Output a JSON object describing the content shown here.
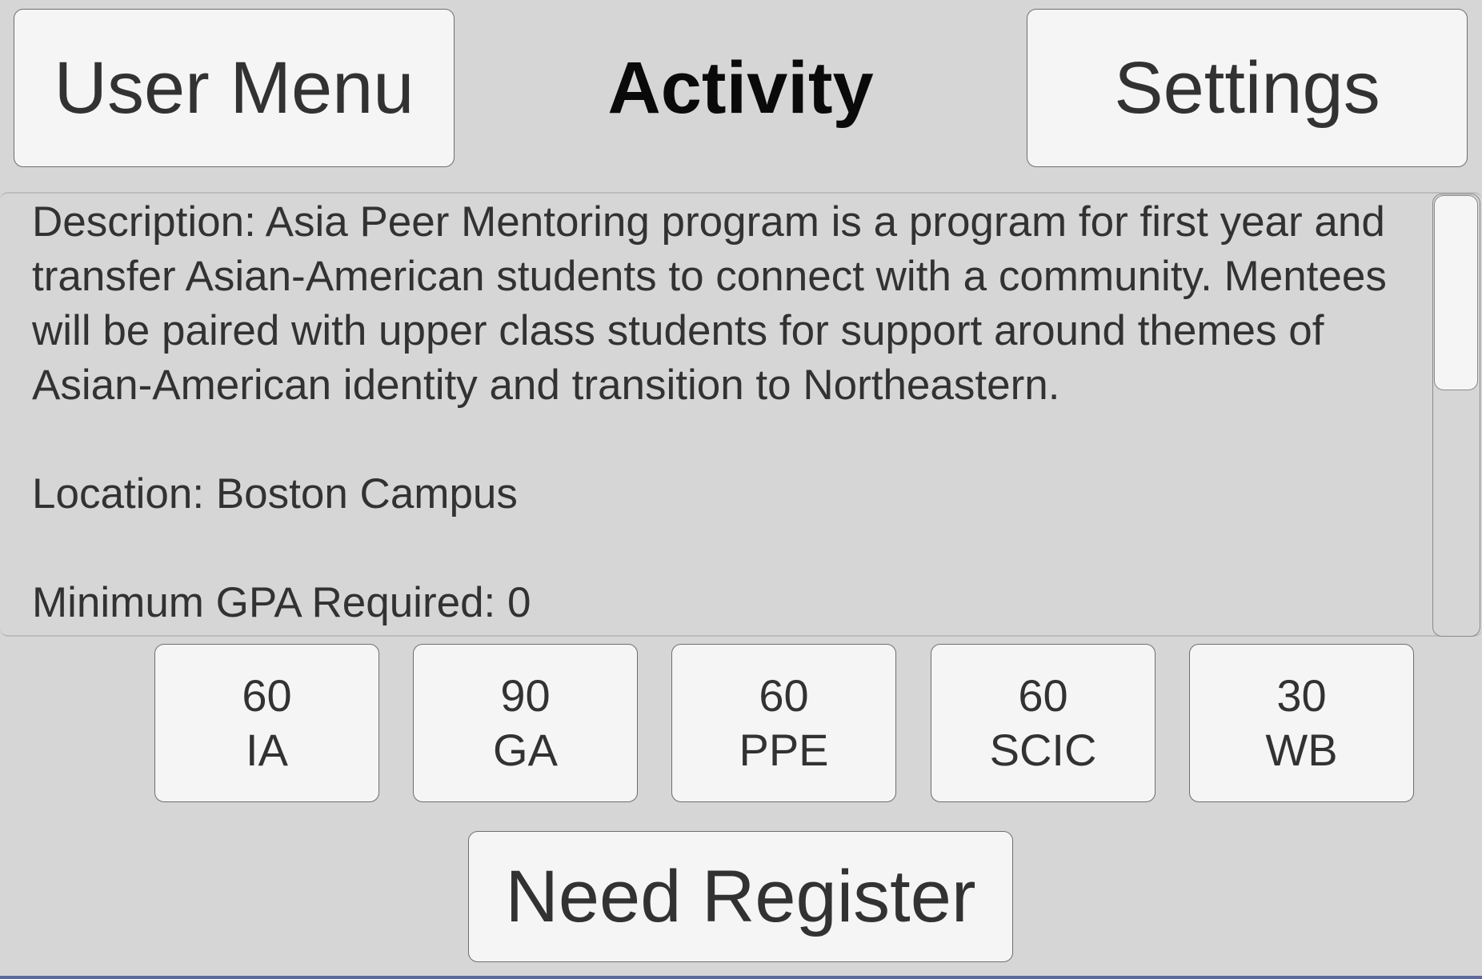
{
  "header": {
    "user_menu_label": "User Menu",
    "title": "Activity",
    "settings_label": "Settings"
  },
  "activity": {
    "description": "Description: Asia Peer Mentoring program is a program for first year and transfer Asian-American students to connect with a community. Mentees will be paired with upper class students for support around themes of Asian-American identity and transition to Northeastern.\n\nLocation: Boston Campus\n\nMinimum GPA Required: 0"
  },
  "requirements": [
    {
      "value": "60",
      "code": "IA"
    },
    {
      "value": "90",
      "code": "GA"
    },
    {
      "value": "60",
      "code": "PPE"
    },
    {
      "value": "60",
      "code": "SCIC"
    },
    {
      "value": "30",
      "code": "WB"
    }
  ],
  "register": {
    "label": "Need Register"
  }
}
